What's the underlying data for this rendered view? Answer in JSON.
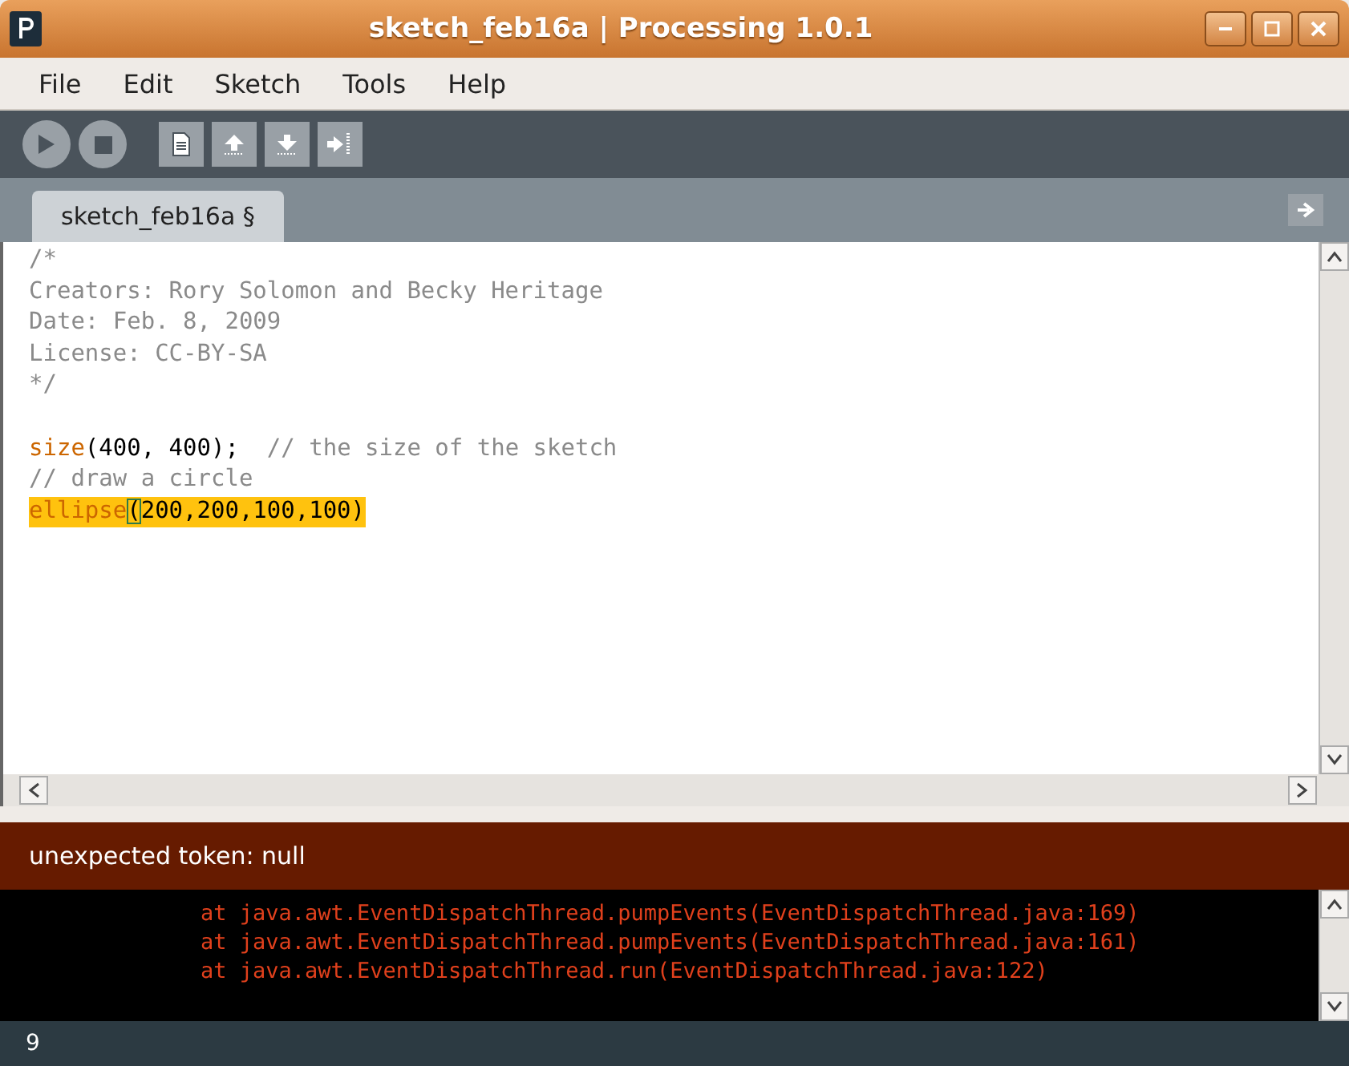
{
  "window": {
    "title": "sketch_feb16a | Processing 1.0.1"
  },
  "menu": [
    "File",
    "Edit",
    "Sketch",
    "Tools",
    "Help"
  ],
  "toolbar": [
    {
      "kind": "run"
    },
    {
      "kind": "stop"
    },
    {
      "kind": "new"
    },
    {
      "kind": "open"
    },
    {
      "kind": "save"
    },
    {
      "kind": "export"
    }
  ],
  "tabs": [
    {
      "label": "sketch_feb16a §",
      "selected": true
    }
  ],
  "code_lines": [
    {
      "selected": false,
      "segments": [
        {
          "kind": "comment",
          "text": "/*"
        }
      ]
    },
    {
      "selected": false,
      "segments": [
        {
          "kind": "comment",
          "text": "Creators: Rory Solomon and Becky Heritage"
        }
      ]
    },
    {
      "selected": false,
      "segments": [
        {
          "kind": "comment",
          "text": "Date: Feb. 8, 2009"
        }
      ]
    },
    {
      "selected": false,
      "segments": [
        {
          "kind": "comment",
          "text": "License: CC-BY-SA"
        }
      ]
    },
    {
      "selected": false,
      "segments": [
        {
          "kind": "comment",
          "text": "*/"
        }
      ]
    },
    {
      "selected": false
    },
    {
      "selected": false,
      "segments": [
        {
          "kind": "function",
          "text": "size"
        },
        {
          "kind": "plain",
          "text": "(400, 400);  "
        },
        {
          "kind": "comment",
          "text": "// the size of the sketch"
        }
      ]
    },
    {
      "selected": false,
      "segments": [
        {
          "kind": "comment",
          "text": "// draw a circle"
        }
      ]
    },
    {
      "selected": true,
      "segments": [
        {
          "kind": "function",
          "text": "ellipse"
        },
        {
          "kind": "caret",
          "text": "("
        },
        {
          "kind": "plain",
          "text": "200,200,100,100)"
        }
      ]
    }
  ],
  "message": "unexpected token: null",
  "console_lines": [
    "        at java.awt.EventDispatchThread.pumpEvents(EventDispatchThread.java:169)",
    "        at java.awt.EventDispatchThread.pumpEvents(EventDispatchThread.java:161)",
    "        at java.awt.EventDispatchThread.run(EventDispatchThread.java:122)"
  ],
  "status": {
    "line": "9"
  }
}
